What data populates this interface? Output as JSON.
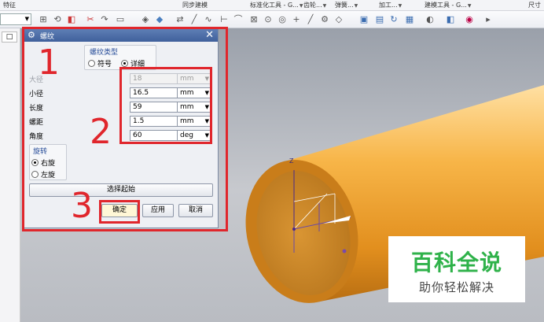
{
  "ribbon": {
    "labels": [
      "特征",
      "同步建模",
      "标准化工具 - G...",
      "齿轮...",
      "弹簧...",
      "加工...",
      "建模工具 - G...",
      "尺寸"
    ]
  },
  "left_panel": {
    "tab_glyph": "□"
  },
  "dialog": {
    "title": "螺纹",
    "close_glyph": "✕",
    "thread_type": {
      "title": "螺纹类型",
      "options": [
        "符号",
        "详细"
      ],
      "selected": "详细"
    },
    "params": [
      {
        "label": "大径",
        "value": "18",
        "unit": "mm",
        "disabled": true
      },
      {
        "label": "小径",
        "value": "16.5",
        "unit": "mm",
        "disabled": false
      },
      {
        "label": "长度",
        "value": "59",
        "unit": "mm",
        "disabled": false
      },
      {
        "label": "螺距",
        "value": "1.5",
        "unit": "mm",
        "disabled": false
      },
      {
        "label": "角度",
        "value": "60",
        "unit": "deg",
        "disabled": false
      }
    ],
    "rotation": {
      "title": "旋转",
      "options": [
        "右旋",
        "左旋"
      ],
      "selected": "右旋"
    },
    "select_start_label": "选择起始",
    "ok_label": "确定",
    "apply_label": "应用",
    "cancel_label": "取消"
  },
  "annotations": [
    "1",
    "2",
    "3"
  ],
  "viewport": {
    "axis_label": "Z"
  },
  "watermark": {
    "title": "百科全说",
    "subtitle": "助你轻松解决"
  },
  "colors": {
    "annotation_red": "#e0262c",
    "cylinder_orange": "#f0a53a",
    "watermark_green": "#2fb24a"
  }
}
